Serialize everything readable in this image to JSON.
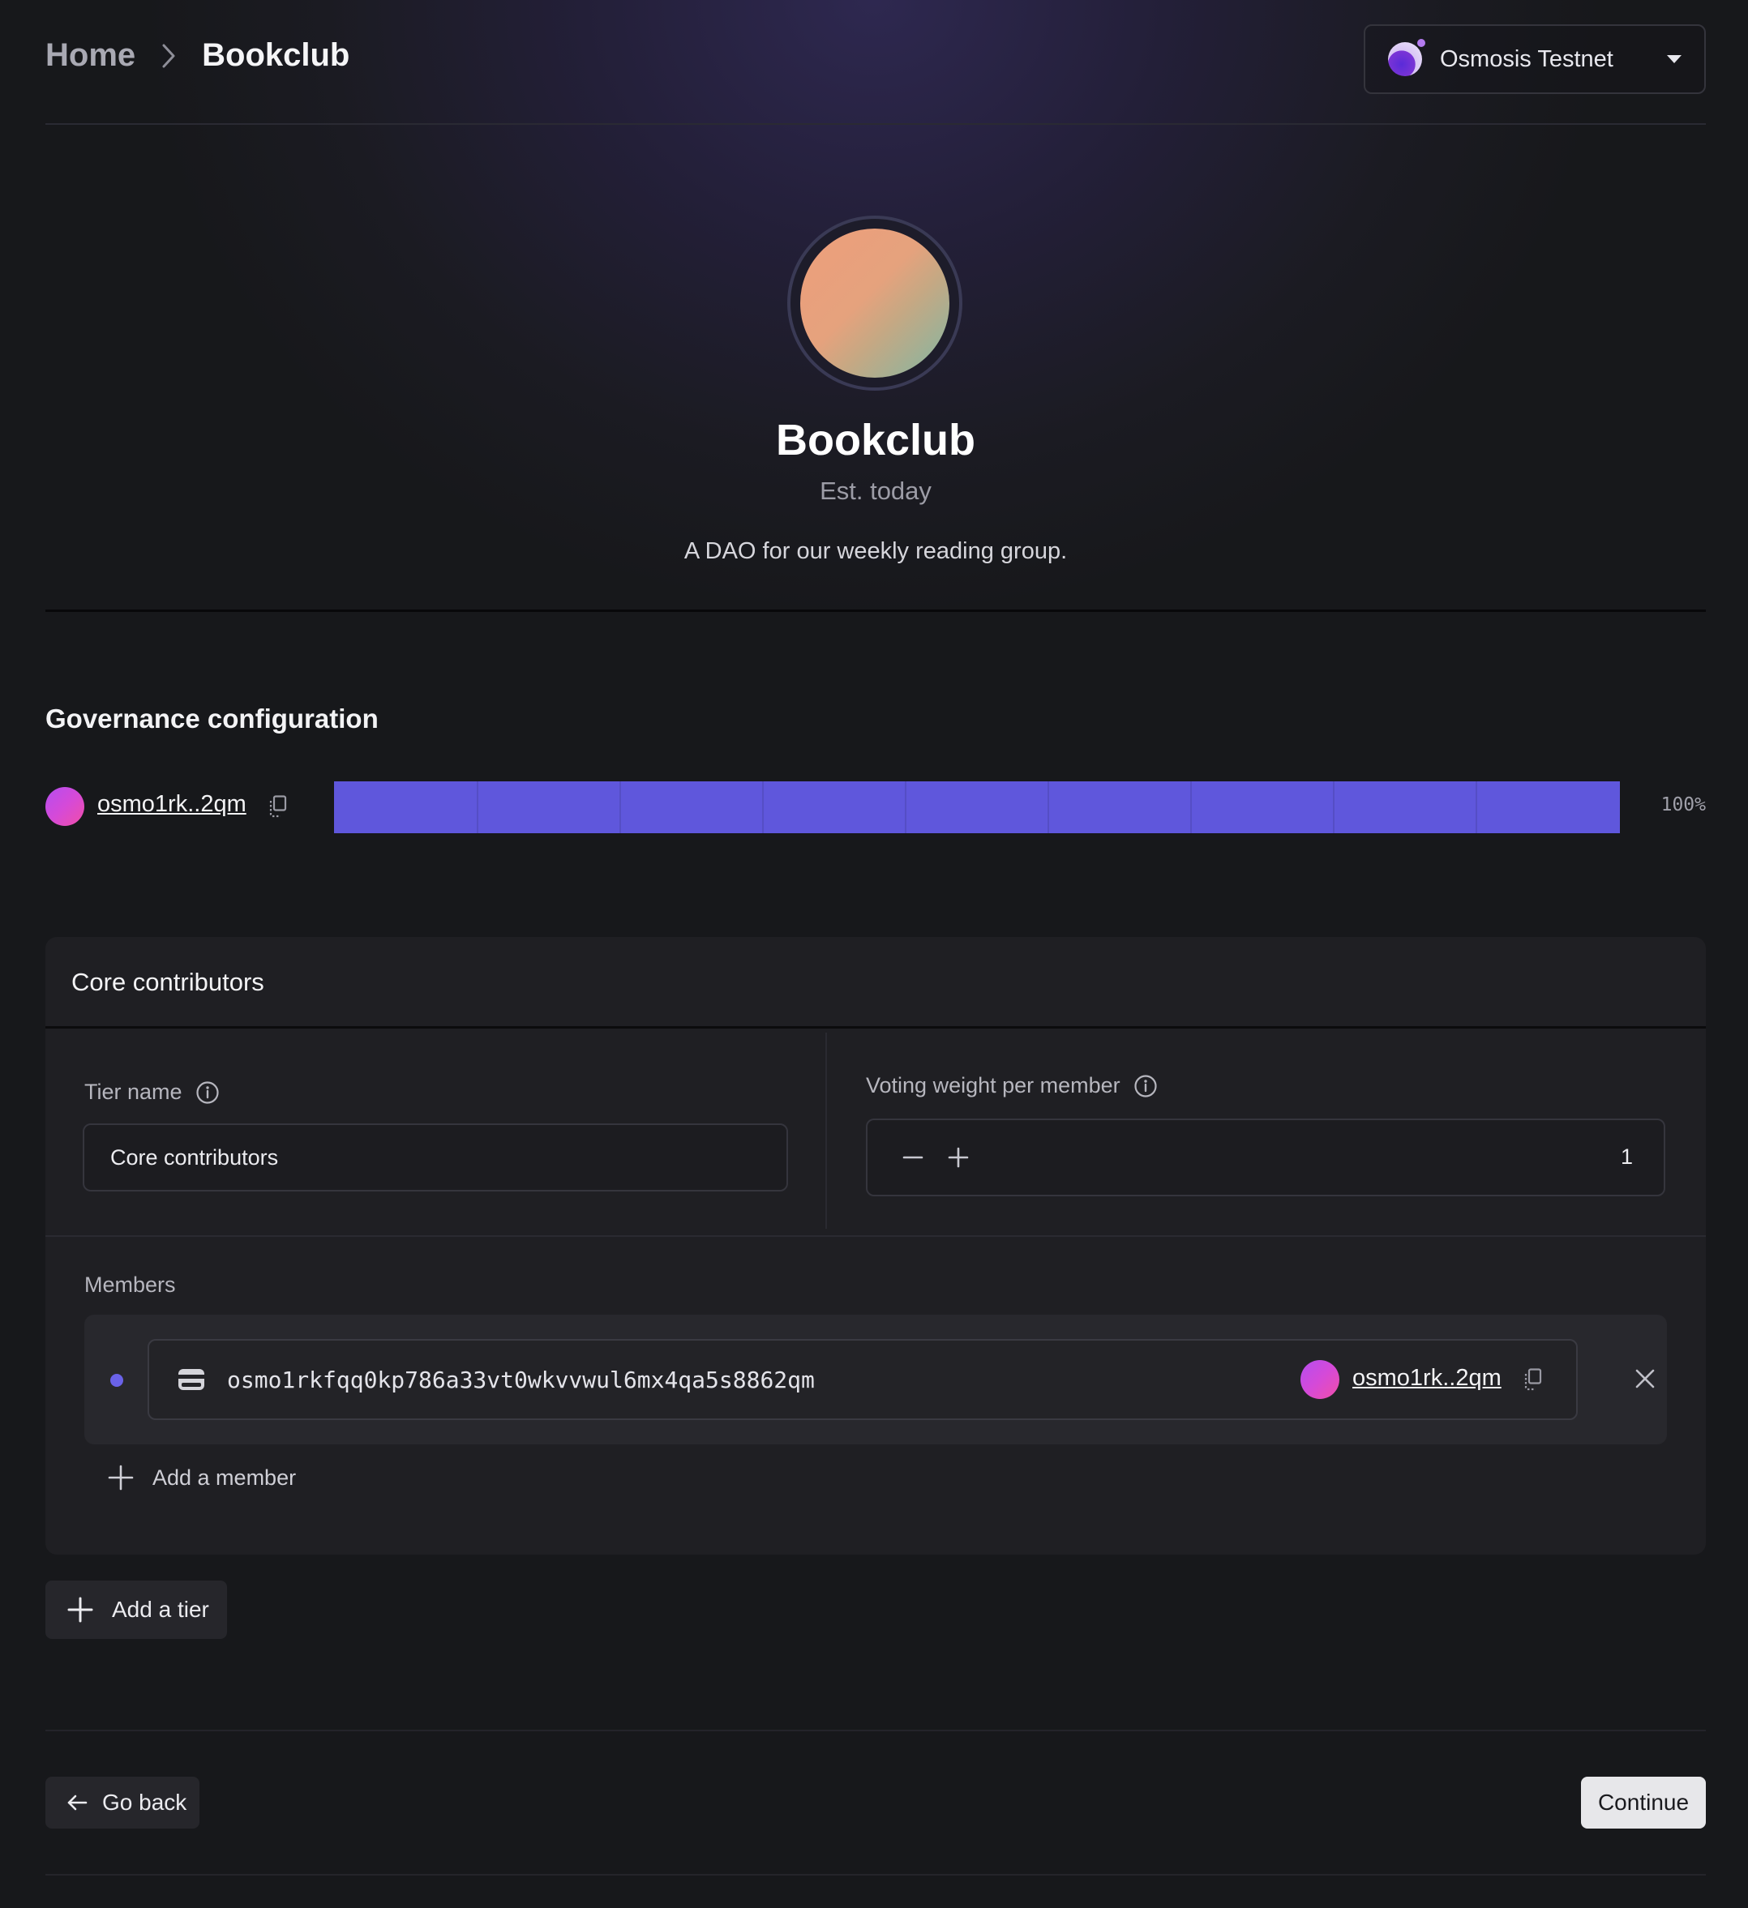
{
  "header": {
    "breadcrumb": {
      "home": "Home",
      "current": "Bookclub"
    },
    "chain_selector": {
      "label": "Osmosis Testnet",
      "icon": "osmosis-logo"
    }
  },
  "dao": {
    "name": "Bookclub",
    "established": "Est. today",
    "description": "A DAO for our weekly reading group."
  },
  "governance": {
    "title": "Governance configuration",
    "entries": [
      {
        "address_short": "osmo1rk..2qm",
        "percent_label": "100%",
        "fraction": 1.0,
        "bar_color": "#5f57dc"
      }
    ]
  },
  "tier": {
    "title": "Core contributors",
    "tier_name_label": "Tier name",
    "tier_name_value": "Core contributors",
    "voting_weight_label": "Voting weight per member",
    "voting_weight_value": "1",
    "members_label": "Members",
    "members": [
      {
        "address": "osmo1rkfqq0kp786a33vt0wkvvwul6mx4qa5s8862qm",
        "address_short": "osmo1rk..2qm"
      }
    ],
    "add_member_label": "Add a member"
  },
  "add_tier_label": "Add a tier",
  "footer": {
    "back_label": "Go back",
    "continue_label": "Continue"
  },
  "colors": {
    "accent": "#5f57dc",
    "background": "#17181b",
    "card": "#1f1f23"
  }
}
